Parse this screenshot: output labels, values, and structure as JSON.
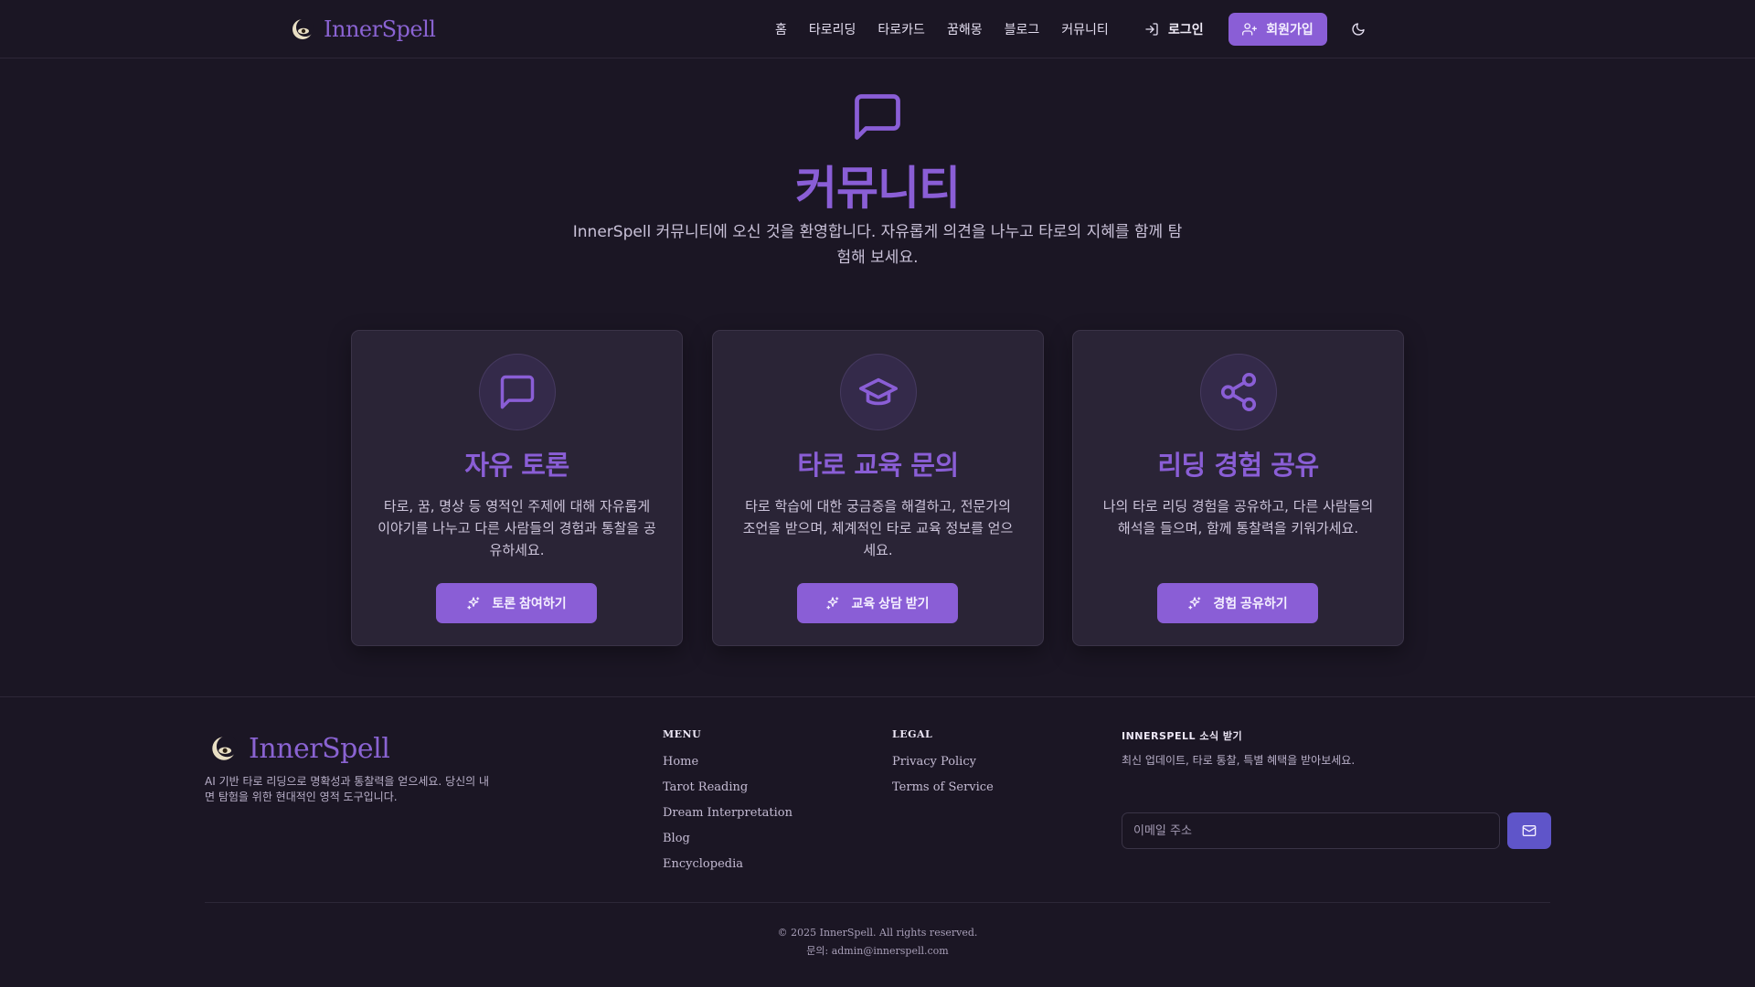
{
  "app": {
    "brand": "InnerSpell"
  },
  "header": {
    "nav": [
      {
        "label": "홈"
      },
      {
        "label": "타로리딩"
      },
      {
        "label": "타로카드"
      },
      {
        "label": "꿈해몽"
      },
      {
        "label": "블로그"
      },
      {
        "label": "커뮤니티"
      }
    ],
    "login_label": "로그인",
    "signup_label": "회원가입",
    "theme_icon": "moon-icon"
  },
  "hero": {
    "icon": "message-square-icon",
    "title": "커뮤니티",
    "subtitle": "InnerSpell 커뮤니티에 오신 것을 환영합니다. 자유롭게 의견을 나누고 타로의 지혜를 함께 탐험해 보세요."
  },
  "cards": [
    {
      "icon": "message-square-icon",
      "title": "자유 토론",
      "description": "타로, 꿈, 명상 등 영적인 주제에 대해 자유롭게 이야기를 나누고 다른 사람들의 경험과 통찰을 공유하세요.",
      "button_label": "토론 참여하기",
      "button_icon": "sparkles-icon"
    },
    {
      "icon": "graduation-cap-icon",
      "title": "타로 교육 문의",
      "description": "타로 학습에 대한 궁금증을 해결하고, 전문가의 조언을 받으며, 체계적인 타로 교육 정보를 얻으세요.",
      "button_label": "교육 상담 받기",
      "button_icon": "sparkles-icon"
    },
    {
      "icon": "share-icon",
      "title": "리딩 경험 공유",
      "description": "나의 타로 리딩 경험을 공유하고, 다른 사람들의 해석을 들으며, 함께 통찰력을 키워가세요.",
      "button_label": "경험 공유하기",
      "button_icon": "sparkles-icon"
    }
  ],
  "footer": {
    "brand": "InnerSpell",
    "description": "AI 기반 타로 리딩으로 명확성과 통찰력을 얻으세요. 당신의 내면 탐험을 위한 현대적인 영적 도구입니다.",
    "menu": {
      "title": "MENU",
      "links": [
        "Home",
        "Tarot Reading",
        "Dream Interpretation",
        "Blog",
        "Encyclopedia"
      ]
    },
    "legal": {
      "title": "LEGAL",
      "links": [
        "Privacy Policy",
        "Terms of Service"
      ]
    },
    "newsletter": {
      "title": "INNERSPELL 소식 받기",
      "description": "최신 업데이트, 타로 통찰, 특별 혜택을 받아보세요.",
      "placeholder": "이메일 주소",
      "submit_icon": "mail-icon"
    },
    "copyright": "© 2025 InnerSpell. All rights reserved.",
    "contact": "문의: admin@innerspell.com"
  },
  "colors": {
    "background": "#1b1624",
    "accent": "#8a5ed6",
    "card": "#2a2436",
    "newsletter_button": "#5f55c9"
  }
}
